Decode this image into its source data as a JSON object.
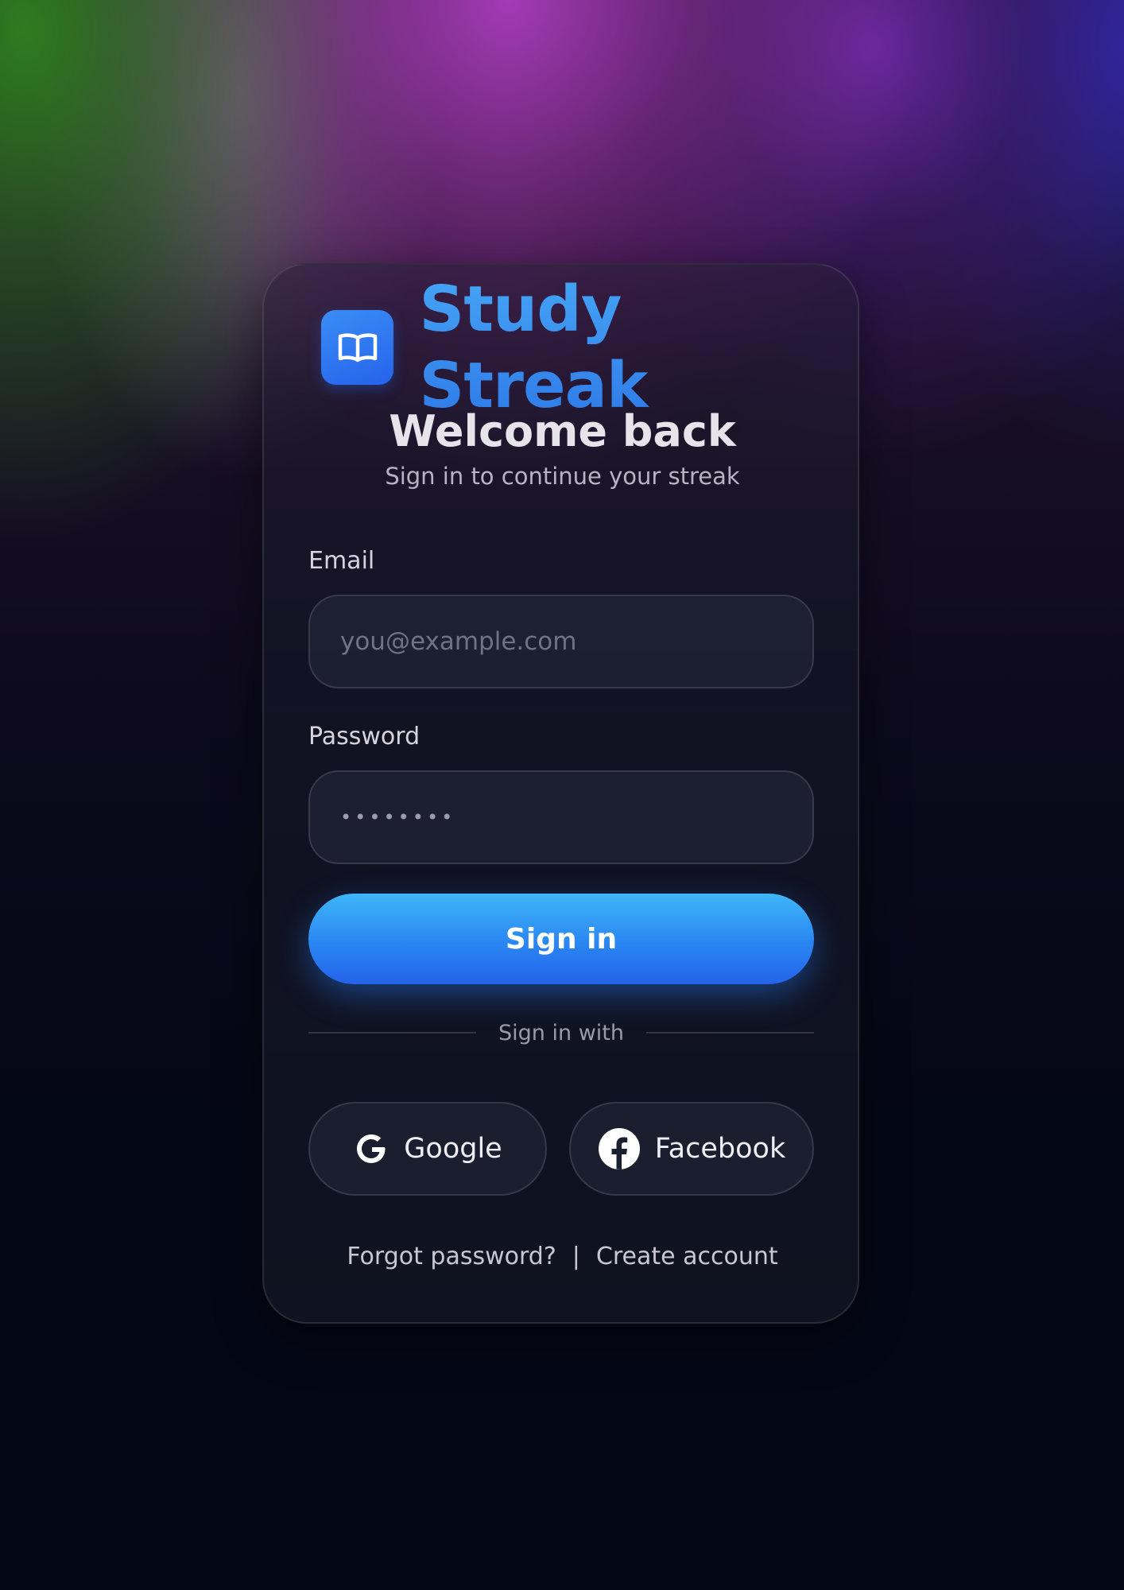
{
  "app": {
    "name": "Study Streak"
  },
  "heading": {
    "title": "Welcome back",
    "subtitle": "Sign in to continue your streak"
  },
  "form": {
    "email_label": "Email",
    "email_placeholder": "you@example.com",
    "password_label": "Password",
    "password_value": "••••••••",
    "submit_label": "Sign in"
  },
  "social": {
    "divider_text": "Sign in with",
    "google_label": "Google",
    "facebook_label": "Facebook"
  },
  "footer": {
    "forgot_label": "Forgot password?",
    "separator": "|",
    "create_label": "Create account"
  },
  "icons": {
    "logo": "book-icon",
    "google": "google-icon",
    "facebook": "facebook-icon"
  },
  "colors": {
    "accent": "#2f86f0",
    "background": "#040716",
    "card": "#141829"
  }
}
